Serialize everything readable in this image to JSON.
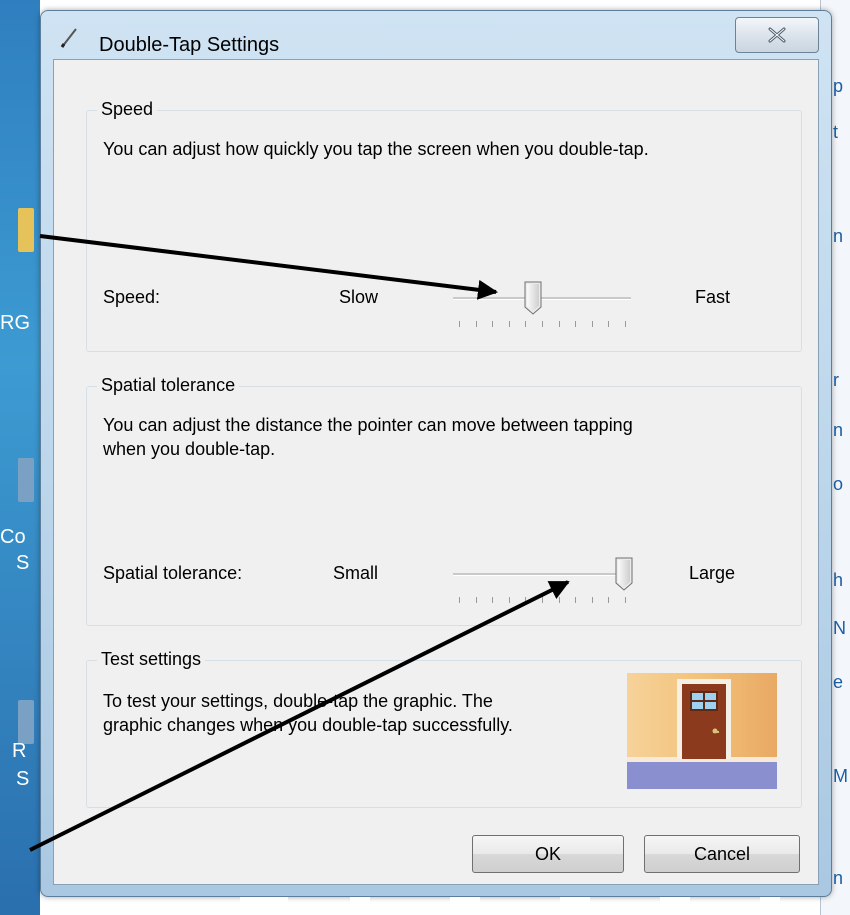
{
  "dialog": {
    "title": "Double-Tap Settings"
  },
  "speed": {
    "group_label": "Speed",
    "description": "You can adjust how quickly you tap the screen when you double-tap.",
    "label": "Speed:",
    "min_label": "Slow",
    "max_label": "Fast",
    "value_fraction": 0.45
  },
  "tolerance": {
    "group_label": "Spatial tolerance",
    "description_line1": "You can adjust the distance the pointer can move between tapping",
    "description_line2": "when you double-tap.",
    "label": "Spatial tolerance:",
    "min_label": "Small",
    "max_label": "Large",
    "value_fraction": 0.96
  },
  "test": {
    "group_label": "Test settings",
    "description_line1": "To test your settings, double-tap the graphic.  The",
    "description_line2": "graphic changes when you double-tap successfully."
  },
  "buttons": {
    "ok": "OK",
    "cancel": "Cancel"
  },
  "desktop": {
    "frag1": "RG",
    "frag2": "Co",
    "frag3": "S",
    "frag4": "R",
    "frag5": "S"
  },
  "background_window": {
    "frags": [
      "p",
      "t",
      "n",
      "r",
      "n",
      "o",
      "h",
      "N",
      "e",
      "M",
      "n"
    ]
  },
  "colors": {
    "accent": "#3c7fb1",
    "door": "#8b3a1e",
    "wall": "#f3c27a",
    "floor": "#8a8fcf"
  }
}
